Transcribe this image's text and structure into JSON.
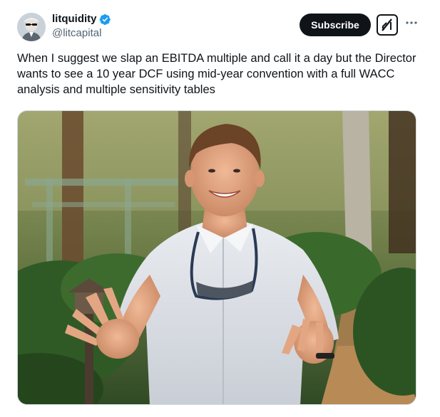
{
  "author": {
    "display_name": "litquidity",
    "handle": "@litcapital",
    "verified": true,
    "verified_color": "#1d9bf0"
  },
  "actions": {
    "subscribe_label": "Subscribe",
    "grok_icon": "grok-icon",
    "more_icon": "more-options-icon"
  },
  "tweet": {
    "text": "When I suggest we slap an EBITDA multiple and call it a day but the Director wants to see a 10 year DCF using mid-year convention with a full WACC analysis and multiple sensitivity tables"
  },
  "media": {
    "type": "photo",
    "alt_description": "smiling man in light button shirt with sunglasses strap around neck, hands raised, tropical garden background"
  }
}
